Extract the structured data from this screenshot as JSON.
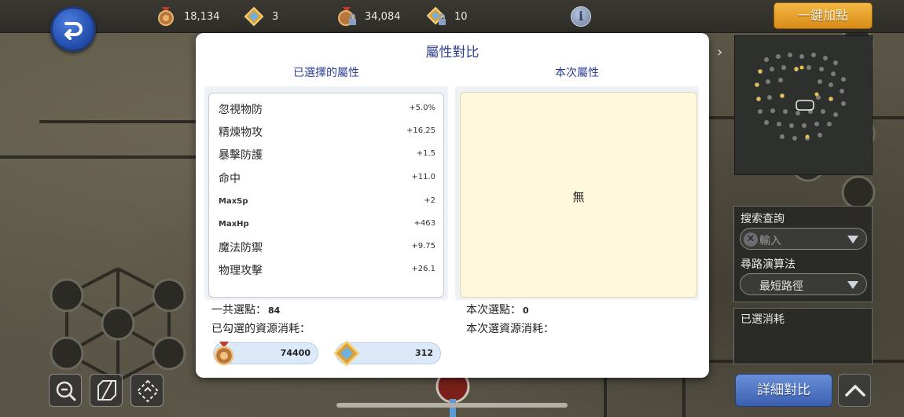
{
  "topbar": {
    "resources": [
      {
        "icon": "medal-icon",
        "value": "18,134"
      },
      {
        "icon": "gem-icon",
        "value": "3"
      },
      {
        "icon": "locked-medal-icon",
        "value": "34,084"
      },
      {
        "icon": "locked-gem-icon",
        "value": "10"
      }
    ],
    "info_glyph": "i",
    "one_key_label": "一鍵加點"
  },
  "modal": {
    "title": "屬性對比",
    "left_header": "已選擇的屬性",
    "right_header": "本次屬性",
    "attributes": [
      {
        "name": "忽視物防",
        "value": "+5.0%"
      },
      {
        "name": "精煉物攻",
        "value": "+16.25"
      },
      {
        "name": "暴擊防護",
        "value": "+1.5"
      },
      {
        "name": "命中",
        "value": "+11.0"
      },
      {
        "name": "MaxSp",
        "value": "+2"
      },
      {
        "name": "MaxHp",
        "value": "+463"
      },
      {
        "name": "魔法防禦",
        "value": "+9.75"
      },
      {
        "name": "物理攻擊",
        "value": "+26.1"
      }
    ],
    "current_none": "無",
    "total_points_label": "一共選點：",
    "total_points_value": "84",
    "checked_cost_label": "已勾選的資源消耗：",
    "current_points_label": "本次選點：",
    "current_points_value": "0",
    "current_cost_label": "本次選資源消耗：",
    "costs": [
      {
        "icon": "medal-icon",
        "value": "74400"
      },
      {
        "icon": "gem-icon",
        "value": "312"
      }
    ]
  },
  "sidebar": {
    "search_label": "搜索查詢",
    "search_placeholder": "輸入",
    "algo_label": "尋路演算法",
    "algo_value": "最短路徑",
    "cost_label": "已選消耗",
    "detail_button": "詳細對比"
  },
  "colors": {
    "title_blue": "#2e3f93",
    "accent_orange": "#e3a02a",
    "button_blue": "#4a6fc0",
    "compare_panel": "#fff8dc"
  }
}
